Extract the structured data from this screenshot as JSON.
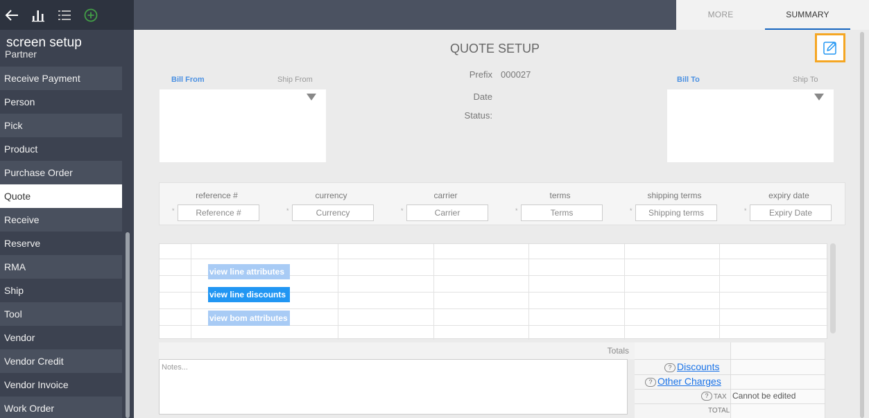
{
  "sidebar": {
    "title": "screen setup",
    "partial_item": "Partner",
    "items": [
      {
        "label": "Receive Payment"
      },
      {
        "label": "Person"
      },
      {
        "label": "Pick"
      },
      {
        "label": "Product"
      },
      {
        "label": "Purchase Order"
      },
      {
        "label": "Quote",
        "active": true
      },
      {
        "label": "Receive"
      },
      {
        "label": "Reserve"
      },
      {
        "label": "RMA"
      },
      {
        "label": "Ship"
      },
      {
        "label": "Tool"
      },
      {
        "label": "Vendor"
      },
      {
        "label": "Vendor Credit"
      },
      {
        "label": "Vendor Invoice"
      },
      {
        "label": "Work Order"
      }
    ]
  },
  "toolbar": {
    "icons": [
      "back-arrow-icon",
      "bar-chart-icon",
      "list-icon",
      "add-circle-icon"
    ],
    "accent_color": "#43a047"
  },
  "tabs": {
    "more": "MORE",
    "summary": "SUMMARY",
    "active_underline_color": "#1565c0"
  },
  "header": {
    "title": "QUOTE SETUP",
    "edit_highlight_color": "#f5a623"
  },
  "addresses": {
    "bill_from": "Bill From",
    "ship_from": "Ship From",
    "bill_to": "Bill To",
    "ship_to": "Ship To"
  },
  "meta": {
    "prefix_label": "Prefix",
    "prefix_value": "000027",
    "date_label": "Date",
    "status_label": "Status:"
  },
  "fields": [
    {
      "label": "reference #",
      "placeholder": "Reference #"
    },
    {
      "label": "currency",
      "placeholder": "Currency"
    },
    {
      "label": "carrier",
      "placeholder": "Carrier"
    },
    {
      "label": "terms",
      "placeholder": "Terms"
    },
    {
      "label": "shipping terms",
      "placeholder": "Shipping terms"
    },
    {
      "label": "expiry date",
      "placeholder": "Expiry Date"
    }
  ],
  "field_required_marker": "*",
  "line_actions": {
    "attributes": "view line attributes",
    "discounts": "view line discounts",
    "bom": "view bom attributes"
  },
  "totals": {
    "header": "Totals",
    "notes_placeholder": "Notes...",
    "discounts": "Discounts",
    "other_charges": "Other Charges",
    "tax_label": "TAX",
    "tax_value": "Cannot be edited",
    "total_label": "TOTAL",
    "help_glyph": "?"
  }
}
